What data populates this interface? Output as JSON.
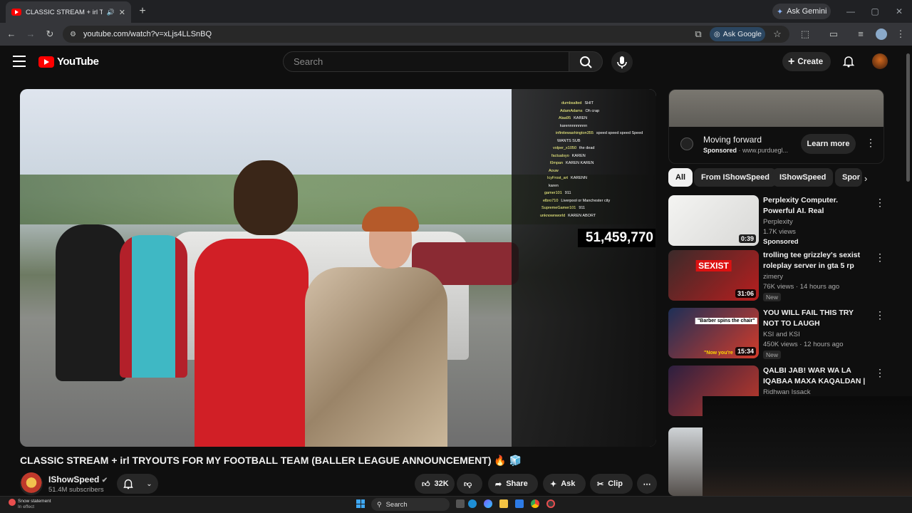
{
  "browser": {
    "tab_title": "CLASSIC STREAM + irl TRYOUTS FOR MY FOOTBALL TEAM",
    "url": "youtube.com/watch?v=xLjs4LLSnBQ",
    "ask_google": "Ask Google",
    "ask_gemini": "Ask Gemini"
  },
  "youtube": {
    "logo_text": "YouTube",
    "search_placeholder": "Search",
    "create_label": "Create"
  },
  "video": {
    "title": "CLASSIC STREAM + irl TRYOUTS FOR MY FOOTBALL TEAM (BALLER LEAGUE ANNOUNCEMENT) 🔥 🧊",
    "counter": "51,459,770",
    "chat": [
      {
        "user": "dumbsalted",
        "msg": "SHIT"
      },
      {
        "user": "AdamAdams",
        "msg": "Oh crap"
      },
      {
        "user": "Alaa95",
        "msg": "KAREN"
      },
      {
        "user": "",
        "msg": "karennnnnnnnn"
      },
      {
        "user": "infinitewashington355",
        "msg": "speed speed speed Speed"
      },
      {
        "user": "",
        "msg": "WANTS SUB"
      },
      {
        "user": "volper_x1050",
        "msg": "the dead"
      },
      {
        "user": "factualsyo",
        "msg": "KAREN"
      },
      {
        "user": "l0mpan",
        "msg": "KAREN KAREN"
      },
      {
        "user": "Aouw",
        "msg": ""
      },
      {
        "user": "IcyFrost_art",
        "msg": "KARENN"
      },
      {
        "user": "",
        "msg": "karen"
      },
      {
        "user": "gamer101",
        "msg": "911"
      },
      {
        "user": "elbro710",
        "msg": "Liverpool or Manchester city"
      },
      {
        "user": "SupremeGamer101",
        "msg": "911"
      },
      {
        "user": "unknownworld",
        "msg": "KAREN ABORT"
      }
    ]
  },
  "channel": {
    "name": "IShowSpeed",
    "subscribers": "51.4M subscribers"
  },
  "actions": {
    "likes": "32K",
    "share": "Share",
    "ask": "Ask",
    "clip": "Clip"
  },
  "ad": {
    "title": "Moving forward",
    "sponsored": "Sponsored",
    "domain": "· www.purduegl...",
    "cta": "Learn more"
  },
  "chips": [
    "All",
    "From IShowSpeed",
    "IShowSpeed",
    "Spor"
  ],
  "recommendations": [
    {
      "title": "Perplexity Computer. Powerful AI. Real Deliverables. Try...",
      "channel": "Perplexity",
      "meta": "1.7K views",
      "extra": "Sponsored",
      "duration": "0:39",
      "colors": [
        "#f4f4f2",
        "#d8d8d6"
      ]
    },
    {
      "title": "trolling tee grizzley's sexist roleplay server in gta 5 rp",
      "channel": "zimery",
      "meta": "76K views · 14 hours ago",
      "extra": "New",
      "duration": "31:06",
      "thumb_text": "SEXIST",
      "colors": [
        "#3a2a2a",
        "#b81e1e"
      ]
    },
    {
      "title": "YOU WILL FAIL THIS TRY NOT TO LAUGH",
      "channel": "KSI and KSI",
      "meta": "450K views · 12 hours ago",
      "extra": "New",
      "duration": "15:34",
      "thumb_text": "\"Barber spins the chair\"",
      "thumb_text2": "\"Now you're",
      "colors": [
        "#1d2f57",
        "#d23b2a"
      ]
    },
    {
      "title": "QALBI JAB! WAR WA LA IQABAA MAXA KAQALDAN | ...",
      "channel": "Ridhwan Issack",
      "meta": "",
      "extra": "",
      "duration": "",
      "colors": [
        "#2b1f40",
        "#c23a2a"
      ]
    }
  ],
  "taskbar": {
    "weather_title": "Snow statement",
    "weather_sub": "In effect",
    "search": "Search"
  }
}
